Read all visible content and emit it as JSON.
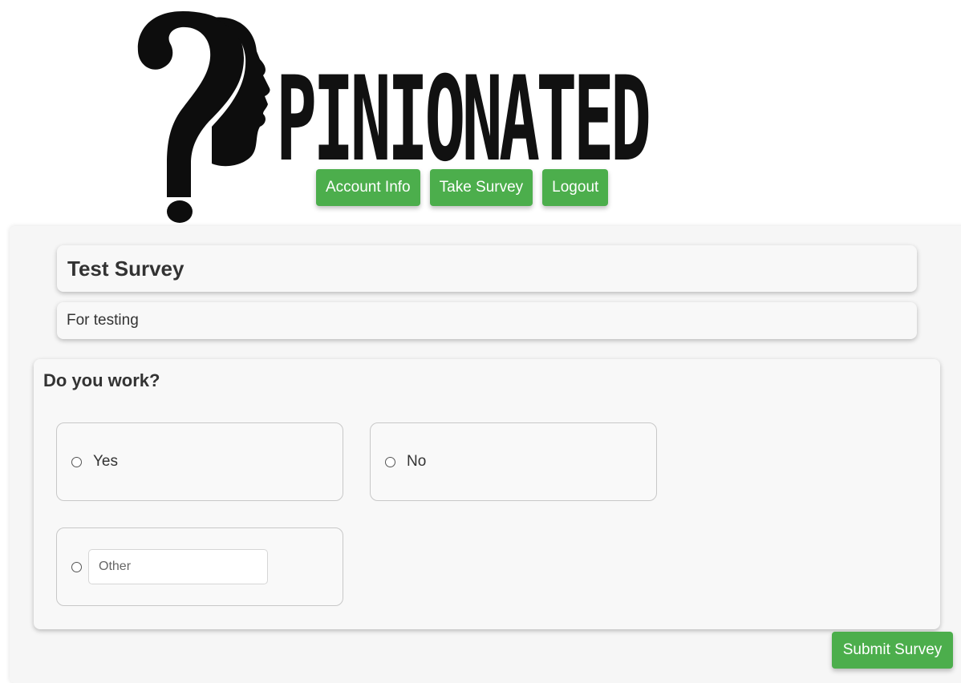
{
  "brand": {
    "logo_text": "PINIONATED",
    "logo_icon": "question-mark-face-icon"
  },
  "nav": {
    "account_info": "Account Info",
    "take_survey": "Take Survey",
    "logout": "Logout",
    "button_color": "#4cae4c"
  },
  "survey": {
    "title": "Test Survey",
    "description": "For testing",
    "question": {
      "text": "Do you work?",
      "options": [
        {
          "label": "Yes",
          "selected": false
        },
        {
          "label": "No",
          "selected": false
        }
      ],
      "other": {
        "placeholder": "Other",
        "value": "",
        "selected": false
      }
    }
  },
  "actions": {
    "submit_label": "Submit Survey"
  }
}
